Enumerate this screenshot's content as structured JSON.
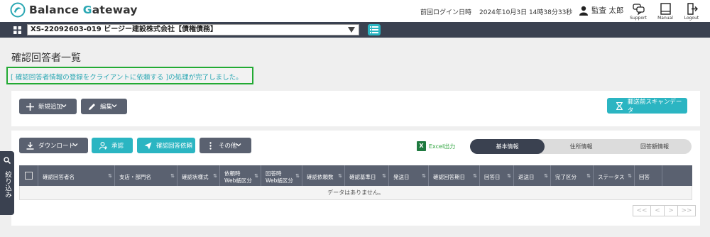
{
  "header": {
    "logo_prefix": "Balance ",
    "logo_highlight": "G",
    "logo_suffix": "ateway",
    "last_login_label": "前回ログイン日時",
    "last_login_value": "2024年10月3日 14時38分33秒",
    "user_name": "監査 太郎",
    "support_label": "Support",
    "manual_label": "Manual",
    "logout_label": "Logout"
  },
  "context": {
    "client_value": "XS-22092603-019 ビージー建設株式会社【債権債務】"
  },
  "page": {
    "title": "確認回答者一覧",
    "notice": "[ 確認回答者情報の登録をクライアントに依頼する ]の処理が完了しました。"
  },
  "toolbar1": {
    "add_label": "新規追加",
    "edit_label": "編集",
    "scan_label": "郵送前スキャンデータ"
  },
  "toolbar2": {
    "download_label": "ダウンロード",
    "approve_label": "承認",
    "request_label": "確認回答依頼",
    "other_label": "その他",
    "excel_label": "Excel出力"
  },
  "tabs": [
    {
      "label": "基本情報",
      "active": true
    },
    {
      "label": "住所情報",
      "active": false
    },
    {
      "label": "回答額情報",
      "active": false
    }
  ],
  "table": {
    "columns": [
      {
        "l1": "確認回答者名",
        "l2": ""
      },
      {
        "l1": "支店・部門名",
        "l2": ""
      },
      {
        "l1": "確認状様式",
        "l2": ""
      },
      {
        "l1": "依頼時",
        "l2": "Web紙区分"
      },
      {
        "l1": "回答時",
        "l2": "Web紙区分"
      },
      {
        "l1": "確認依頼数",
        "l2": ""
      },
      {
        "l1": "確認基準日",
        "l2": ""
      },
      {
        "l1": "発送日",
        "l2": ""
      },
      {
        "l1": "確認回答期日",
        "l2": ""
      },
      {
        "l1": "回答日",
        "l2": ""
      },
      {
        "l1": "返送日",
        "l2": ""
      },
      {
        "l1": "完了区分",
        "l2": ""
      },
      {
        "l1": "ステータス",
        "l2": ""
      },
      {
        "l1": "回答",
        "l2": ""
      }
    ],
    "empty_message": "データはありません。"
  },
  "pager": {
    "first": "<<",
    "prev": "<",
    "next": ">",
    "last": ">>"
  },
  "side_tab": {
    "label": "絞り込み"
  },
  "colors": {
    "accent": "#2bb5c2",
    "dark": "#3a4150",
    "button": "#5a6170",
    "notice_border": "#22aa33"
  }
}
